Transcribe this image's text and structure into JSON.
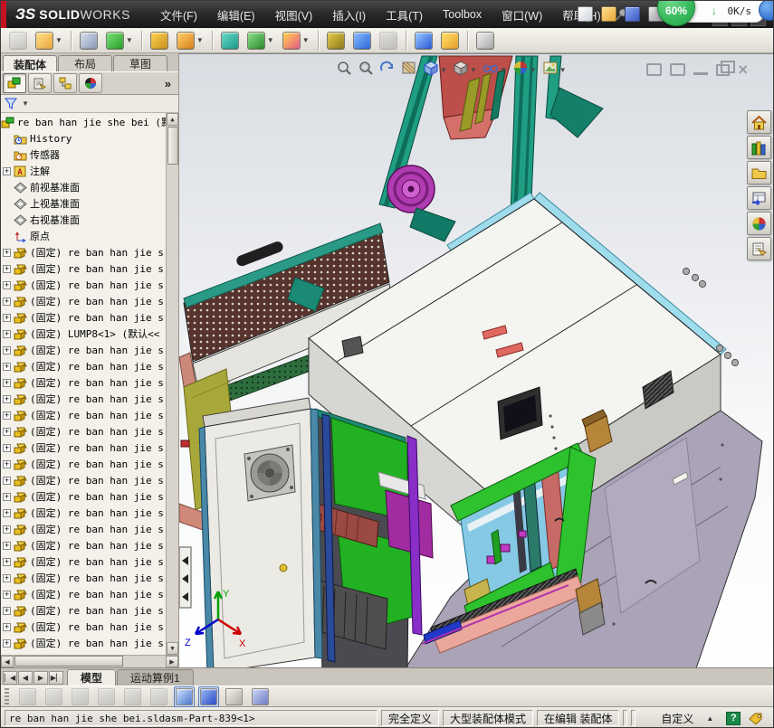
{
  "window": {
    "logo_glyph": "ЗS",
    "brand_bold": "SOLID",
    "brand_light": "WORKS"
  },
  "menubar": {
    "items": [
      "文件(F)",
      "编辑(E)",
      "视图(V)",
      "插入(I)",
      "工具(T)",
      "Toolbox",
      "窗口(W)",
      "帮助(H)"
    ]
  },
  "quickbar": {
    "items": [
      {
        "name": "new-document-icon",
        "color": "linear-gradient(135deg,#ffffff,#cfd4da)"
      },
      {
        "name": "open-folder-icon",
        "color": "linear-gradient(135deg,#ffe08a,#e8a83a)"
      },
      {
        "name": "save-icon",
        "color": "linear-gradient(135deg,#8aa8f0,#3a5ac8)"
      },
      {
        "name": "print-icon",
        "color": "linear-gradient(135deg,#e8e8e8,#9a9aa2)"
      }
    ]
  },
  "overlay": {
    "percent": "60%",
    "speed": "0K/s"
  },
  "toolbar": {
    "items": [
      {
        "name": "insert-component-icon",
        "color": "linear-gradient(135deg,#e2e2e2,#9a9a9a)",
        "disabled": true
      },
      {
        "name": "open-document-icon",
        "color": "linear-gradient(135deg,#ffe08a,#e8a83a)",
        "caret": true
      },
      {
        "sep": true
      },
      {
        "name": "mate-paperclip-icon",
        "color": "linear-gradient(135deg,#d8dfe8,#8a9ab8)"
      },
      {
        "name": "linear-pattern-icon",
        "color": "linear-gradient(135deg,#7ae07a,#28a028)",
        "caret": true
      },
      {
        "sep": true
      },
      {
        "name": "smart-fasteners-icon",
        "color": "linear-gradient(135deg,#ffd34a,#c89020)"
      },
      {
        "name": "rotate-component-icon",
        "color": "linear-gradient(135deg,#ffcf6a,#d8821a)",
        "caret": true
      },
      {
        "sep": true
      },
      {
        "name": "move-component-icon",
        "color": "linear-gradient(135deg,#6ad8c8,#1a9a8a)"
      },
      {
        "name": "assembly-features-icon",
        "color": "linear-gradient(135deg,#8ae08a,#2a8a2a)",
        "caret": true
      },
      {
        "name": "reference-geometry-icon",
        "color": "linear-gradient(135deg,#ffd34a,#e85a8a)",
        "caret": true
      },
      {
        "sep": true
      },
      {
        "name": "motion-gears-icon",
        "color": "linear-gradient(135deg,#e8c84a,#8a7a1a)"
      },
      {
        "name": "exploded-view-icon",
        "color": "linear-gradient(135deg,#8ab8ff,#2a6ad8)"
      },
      {
        "name": "interference-check-icon",
        "color": "linear-gradient(135deg,#c8c8c8,#8a8a8a)",
        "disabled": true
      },
      {
        "sep": true
      },
      {
        "name": "measure-arrow-icon",
        "color": "linear-gradient(135deg,#9ac8ff,#2a5ad8)"
      },
      {
        "name": "simulation-warning-icon",
        "color": "linear-gradient(135deg,#ffe06a,#e8a02a)"
      },
      {
        "sep": true
      },
      {
        "name": "image-frame-icon",
        "color": "linear-gradient(135deg,#f0f0f0,#a8a8a8)"
      }
    ]
  },
  "panel": {
    "tabs": [
      {
        "label": "装配体",
        "active": true
      },
      {
        "label": "布局",
        "active": false
      },
      {
        "label": "草图",
        "active": false
      }
    ],
    "header_icons": [
      {
        "name": "featuremanager-icon",
        "active": true
      },
      {
        "name": "propertymanager-icon",
        "active": false
      },
      {
        "name": "configurationmanager-icon",
        "active": false
      },
      {
        "name": "displaymanager-icon",
        "active": false
      }
    ],
    "more_chevron": "»",
    "tree": {
      "items": [
        {
          "icon": "assembly-icon",
          "label": "re ban han jie she bei (默",
          "level": 0
        },
        {
          "icon": "history-folder-icon",
          "label": "History",
          "level": 1
        },
        {
          "icon": "sensors-folder-icon",
          "label": "传感器",
          "level": 1
        },
        {
          "icon": "annotations-icon",
          "label": "注解",
          "level": 1,
          "expand": true
        },
        {
          "icon": "plane-icon",
          "label": "前视基准面",
          "level": 1
        },
        {
          "icon": "plane-icon",
          "label": "上视基准面",
          "level": 1
        },
        {
          "icon": "plane-icon",
          "label": "右视基准面",
          "level": 1
        },
        {
          "icon": "origin-icon",
          "label": "原点",
          "level": 1
        },
        {
          "icon": "component-icon",
          "label": "(固定) re ban han jie s",
          "level": 1,
          "expand": true
        },
        {
          "icon": "component-icon",
          "label": "(固定) re ban han jie s",
          "level": 1,
          "expand": true
        },
        {
          "icon": "component-icon",
          "label": "(固定) re ban han jie s",
          "level": 1,
          "expand": true
        },
        {
          "icon": "component-icon",
          "label": "(固定) re ban han jie s",
          "level": 1,
          "expand": true
        },
        {
          "icon": "component-icon",
          "label": "(固定) re ban han jie s",
          "level": 1,
          "expand": true
        },
        {
          "icon": "component-icon",
          "label": "(固定) LUMP8<1> (默认<<",
          "level": 1,
          "expand": true
        },
        {
          "icon": "component-icon",
          "label": "(固定) re ban han jie s",
          "level": 1,
          "expand": true
        },
        {
          "icon": "component-icon",
          "label": "(固定) re ban han jie s",
          "level": 1,
          "expand": true
        },
        {
          "icon": "component-icon",
          "label": "(固定) re ban han jie s",
          "level": 1,
          "expand": true
        },
        {
          "icon": "component-icon",
          "label": "(固定) re ban han jie s",
          "level": 1,
          "expand": true
        },
        {
          "icon": "component-icon",
          "label": "(固定) re ban han jie s",
          "level": 1,
          "expand": true
        },
        {
          "icon": "component-icon",
          "label": "(固定) re ban han jie s",
          "level": 1,
          "expand": true
        },
        {
          "icon": "component-icon",
          "label": "(固定) re ban han jie s",
          "level": 1,
          "expand": true
        },
        {
          "icon": "component-icon",
          "label": "(固定) re ban han jie s",
          "level": 1,
          "expand": true
        },
        {
          "icon": "component-icon",
          "label": "(固定) re ban han jie s",
          "level": 1,
          "expand": true
        },
        {
          "icon": "component-icon",
          "label": "(固定) re ban han jie s",
          "level": 1,
          "expand": true
        },
        {
          "icon": "component-icon",
          "label": "(固定) re ban han jie s",
          "level": 1,
          "expand": true
        },
        {
          "icon": "component-icon",
          "label": "(固定) re ban han jie s",
          "level": 1,
          "expand": true
        },
        {
          "icon": "component-icon",
          "label": "(固定) re ban han jie s",
          "level": 1,
          "expand": true
        },
        {
          "icon": "component-icon",
          "label": "(固定) re ban han jie s",
          "level": 1,
          "expand": true
        },
        {
          "icon": "component-icon",
          "label": "(固定) re ban han jie s",
          "level": 1,
          "expand": true
        },
        {
          "icon": "component-icon",
          "label": "(固定) re ban han jie s",
          "level": 1,
          "expand": true
        },
        {
          "icon": "component-icon",
          "label": "(固定) re ban han jie s",
          "level": 1,
          "expand": true
        },
        {
          "icon": "component-icon",
          "label": "(固定) re ban han jie s",
          "level": 1,
          "expand": true
        },
        {
          "icon": "component-icon",
          "label": "(固定) re ban han jie s",
          "level": 1,
          "expand": true
        }
      ]
    }
  },
  "viewport": {
    "headsup_icons": [
      {
        "name": "zoom-fit-icon"
      },
      {
        "name": "zoom-area-icon"
      },
      {
        "name": "rotate-view-icon"
      },
      {
        "name": "section-view-icon"
      },
      {
        "name": "view-orientation-icon",
        "caret": true
      },
      {
        "name": "display-style-icon",
        "caret": true
      },
      {
        "name": "hide-show-items-icon",
        "caret": true
      },
      {
        "name": "appearances-icon",
        "caret": true
      },
      {
        "name": "scene-icon",
        "caret": true
      }
    ],
    "taskpane_icons": [
      {
        "name": "resources-home-icon"
      },
      {
        "name": "design-library-icon"
      },
      {
        "name": "file-explorer-icon"
      },
      {
        "name": "view-palette-icon"
      },
      {
        "name": "appearances-ball-icon"
      },
      {
        "name": "custom-properties-icon"
      }
    ],
    "triad": {
      "x": "X",
      "y": "Y",
      "z": "Z"
    },
    "model_colors": {
      "gantry_teal": "#1f9e84",
      "panel_red": "#bc4f4a",
      "pulley_magenta": "#b13cb1",
      "top_white": "#f4f4f0",
      "trim_cyan": "#9fdcec",
      "body_lavender": "#aba3b7",
      "frame_green": "#2ec22e",
      "interior_blue": "#85c9e4",
      "door_white": "#eceae4",
      "plate_yellow": "#a8a83a",
      "hinge_tan": "#b5853a"
    }
  },
  "doctabs": {
    "nav": [
      "▏◀",
      "◀",
      "▶",
      "▶▏"
    ],
    "tabs": [
      {
        "label": "模型",
        "active": true
      },
      {
        "label": "运动算例1",
        "active": false
      }
    ]
  },
  "motionbar": {
    "items": [
      {
        "name": "motion-elements-icon",
        "disabled": true
      },
      {
        "name": "motion-results-icon",
        "disabled": true
      },
      {
        "name": "motion-calculate-icon",
        "disabled": true
      },
      {
        "name": "motion-lines-icon",
        "disabled": true
      },
      {
        "name": "motion-grid-icon",
        "disabled": true
      },
      {
        "name": "motion-keys-icon",
        "disabled": true
      },
      {
        "name": "chart-mode-icon",
        "active": true,
        "color": "linear-gradient(135deg,#cfe4ff,#4a74c8)"
      },
      {
        "name": "cube-mode-icon",
        "active": true,
        "color": "linear-gradient(135deg,#9ab8f0,#2a4ac8)"
      },
      {
        "name": "table-icon",
        "color": "linear-gradient(135deg,#f0f0ea,#b0ada6)"
      },
      {
        "name": "save-results-icon",
        "color": "linear-gradient(135deg,#cfd8f0,#6a7ac8)"
      }
    ]
  },
  "statusbar": {
    "message": "re ban han jie she bei.sldasm-Part-839<1>",
    "segments": [
      "完全定义",
      "大型装配体模式",
      "在编辑 装配体"
    ],
    "custom_label": "自定义",
    "help_glyph": "?"
  }
}
